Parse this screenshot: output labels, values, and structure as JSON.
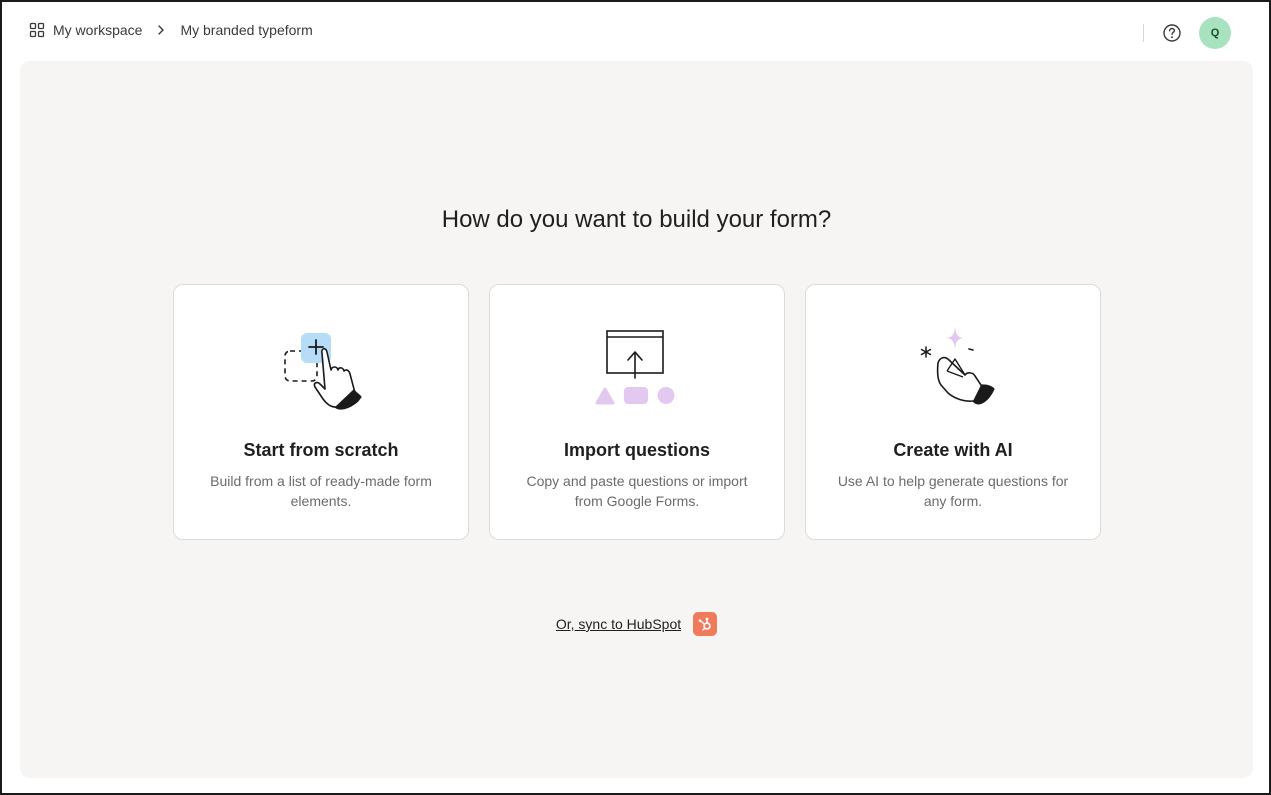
{
  "header": {
    "breadcrumb": {
      "workspace_label": "My workspace",
      "form_label": "My branded typeform"
    },
    "avatar_initial": "Q",
    "icons": [
      "grid-icon",
      "chevron-right-icon",
      "help-circle-icon"
    ]
  },
  "main": {
    "heading": "How do you want to build your form?",
    "cards": [
      {
        "title": "Start from scratch",
        "description": "Build from a list of ready-made form elements.",
        "icon": "hand-add-block-illustration"
      },
      {
        "title": "Import questions",
        "description": "Copy and paste questions or import from Google Forms.",
        "icon": "import-screen-illustration"
      },
      {
        "title": "Create with AI",
        "description": "Use AI to help generate questions for any form.",
        "icon": "ai-sparkle-hand-illustration"
      }
    ],
    "sync_link": "Or, sync to HubSpot",
    "sync_icon": "hubspot-icon"
  },
  "colors": {
    "avatar_bg": "#a9e2be",
    "hubspot": "#f07a5c",
    "canvas_bg": "#f6f5f3",
    "accent_blue": "#b6dcf7",
    "accent_lilac": "#e3c9ef"
  }
}
